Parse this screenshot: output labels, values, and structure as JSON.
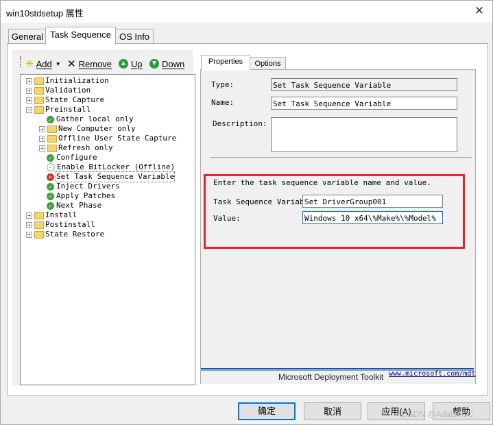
{
  "window": {
    "title": "win10stdsetup 属性",
    "close_glyph": "✕"
  },
  "tabs": [
    {
      "label": "General"
    },
    {
      "label": "Task Sequence"
    },
    {
      "label": "OS Info"
    }
  ],
  "toolbar": {
    "add_label": "Add",
    "remove_label": "Remove",
    "up_label": "Up",
    "down_label": "Down"
  },
  "tree": {
    "nodes": [
      {
        "label": "Initialization",
        "type": "group"
      },
      {
        "label": "Validation",
        "type": "group"
      },
      {
        "label": "State Capture",
        "type": "group"
      },
      {
        "label": "Preinstall",
        "type": "group",
        "expanded": true
      },
      {
        "label": "Gather local only",
        "type": "step"
      },
      {
        "label": "New Computer only",
        "type": "group"
      },
      {
        "label": "Offline User State Capture",
        "type": "group"
      },
      {
        "label": "Refresh only",
        "type": "group"
      },
      {
        "label": "Configure",
        "type": "step"
      },
      {
        "label": "Enable BitLocker (Offline)",
        "type": "step-disabled"
      },
      {
        "label": "Set Task Sequence Variable",
        "type": "step-error",
        "selected": true
      },
      {
        "label": "Inject Drivers",
        "type": "step"
      },
      {
        "label": "Apply Patches",
        "type": "step"
      },
      {
        "label": "Next Phase",
        "type": "step"
      },
      {
        "label": "Install",
        "type": "group"
      },
      {
        "label": "Postinstall",
        "type": "group"
      },
      {
        "label": "State Restore",
        "type": "group"
      }
    ]
  },
  "inner_tabs": [
    {
      "label": "Properties"
    },
    {
      "label": "Options"
    }
  ],
  "properties": {
    "type_label": "Type:",
    "type_value": "Set Task Sequence Variable",
    "name_label": "Name:",
    "name_value": "Set Task Sequence Variable",
    "description_label": "Description:",
    "description_value": ""
  },
  "variable": {
    "instruction": "Enter the task sequence variable name and value.",
    "var_label": "Task Sequence Variable",
    "var_value": "Set DriverGroup001",
    "value_label": "Value:",
    "value_value": "Windows 10 x64\\%Make%\\%Model%"
  },
  "footer": {
    "product": "Microsoft Deployment Toolkit",
    "link": "www.microsoft.com/mdt"
  },
  "buttons": {
    "ok": "确定",
    "cancel": "取消",
    "apply": "应用(A)",
    "help": "帮助"
  },
  "watermark": "CSDN @AdabinCC",
  "colors": {
    "highlight": "#e8222c",
    "accent": "#0078d7",
    "ok_green": "#3aa33a"
  }
}
